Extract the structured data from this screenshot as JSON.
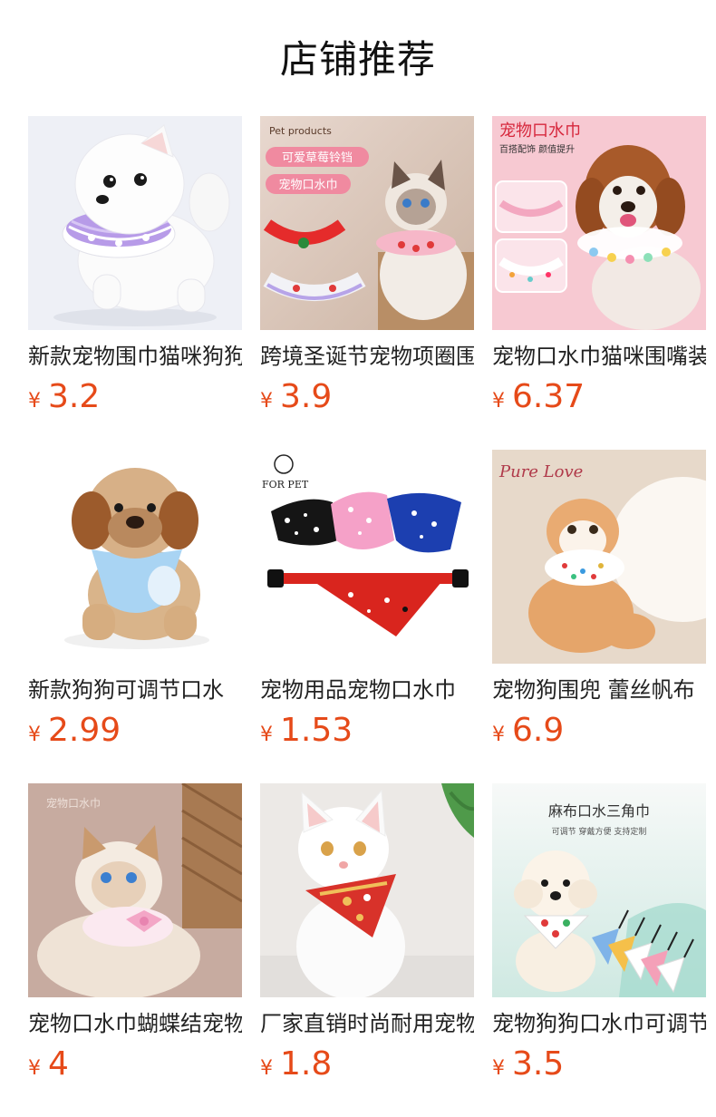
{
  "header": {
    "title": "店铺推荐"
  },
  "colors": {
    "price": "#e64a19"
  },
  "products": [
    {
      "name": "新款宠物围巾猫咪狗狗",
      "currency": "¥",
      "price": "3.2",
      "image": "white-pomeranian-purple-bib"
    },
    {
      "name": "跨境圣诞节宠物项圈围巾",
      "currency": "¥",
      "price": "3.9",
      "image": "cat-strawberry-bibs"
    },
    {
      "name": "宠物口水巾猫咪围嘴装饰",
      "currency": "¥",
      "price": "6.37",
      "image": "poodle-lace-bib"
    },
    {
      "name": "新款狗狗可调节口水",
      "currency": "¥",
      "price": "2.99",
      "image": "plush-dog-blue-bib"
    },
    {
      "name": "宠物用品宠物口水巾",
      "currency": "¥",
      "price": "1.53",
      "image": "paisley-bandanas"
    },
    {
      "name": "宠物狗围兜 蕾丝帆布",
      "currency": "¥",
      "price": "6.9",
      "image": "exotic-cat-lace-bib"
    },
    {
      "name": "宠物口水巾蝴蝶结宠物",
      "currency": "¥",
      "price": "4",
      "image": "ragdoll-pink-bow"
    },
    {
      "name": "厂家直销时尚耐用宠物",
      "currency": "¥",
      "price": "1.8",
      "image": "white-cat-red-bandana"
    },
    {
      "name": "宠物狗狗口水巾可调节",
      "currency": "¥",
      "price": "3.5",
      "image": "poodle-triangle-bibs"
    }
  ],
  "image_text": {
    "pet_products": "Pet products",
    "cute_strawberry_bells": "可爱草莓铃铛",
    "pet_saliva_towel": "宠物口水巾",
    "pet_saliva_towel_title": "宠物口水巾",
    "versatile_tagline": "百搭配饰  颜值提升",
    "for_pet": "FOR PET",
    "pure_love": "Pure Love",
    "saliva_towel_tag": "宠物口水巾",
    "linen_title": "麻布口水三角巾",
    "linen_sub": "可调节  穿戴方便  支持定制"
  }
}
